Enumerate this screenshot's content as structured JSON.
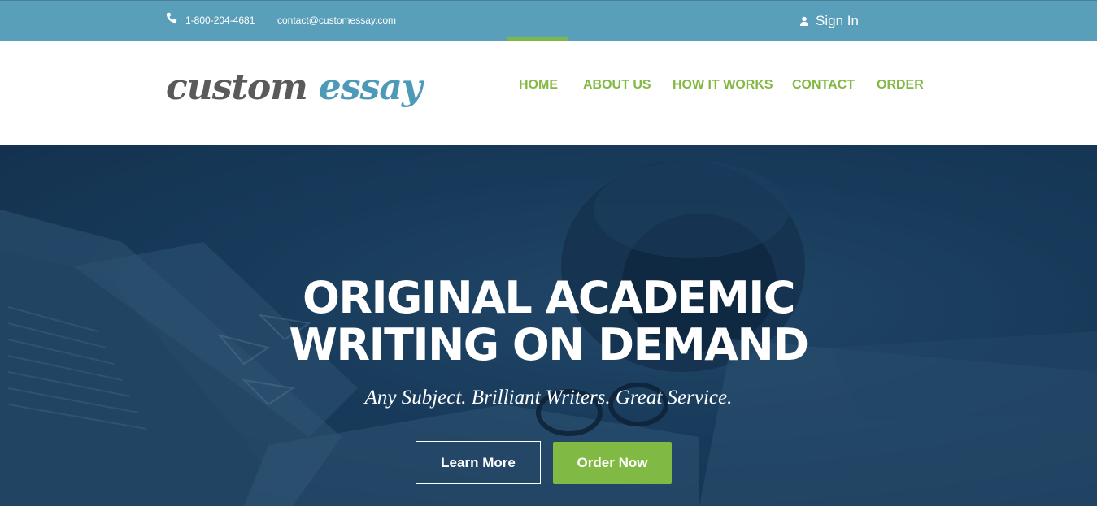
{
  "topbar": {
    "phone": "1-800-204-4681",
    "email": "contact@customessay.com",
    "signin_label": "Sign In",
    "phone_icon": "phone-icon",
    "user_icon": "user-icon"
  },
  "header": {
    "logo_word1": "custom",
    "logo_word2": "essay",
    "nav": [
      {
        "label": "HOME",
        "active": true
      },
      {
        "label": "ABOUT US",
        "active": false
      },
      {
        "label": "HOW IT WORKS",
        "active": false
      },
      {
        "label": "CONTACT",
        "active": false
      },
      {
        "label": "ORDER",
        "active": false
      }
    ]
  },
  "hero": {
    "title_line1": "ORIGINAL ACADEMIC",
    "title_line2": "WRITING ON DEMAND",
    "subtitle": "Any Subject. Brilliant Writers. Great Service.",
    "learn_more_label": "Learn More",
    "order_now_label": "Order Now"
  },
  "colors": {
    "topbar": "#599fba",
    "nav_green": "#83b842",
    "logo_gray": "#5a5a5a",
    "logo_blue": "#4d9ab8",
    "hero_dark": "#1d4160",
    "order_button": "#80b944"
  }
}
